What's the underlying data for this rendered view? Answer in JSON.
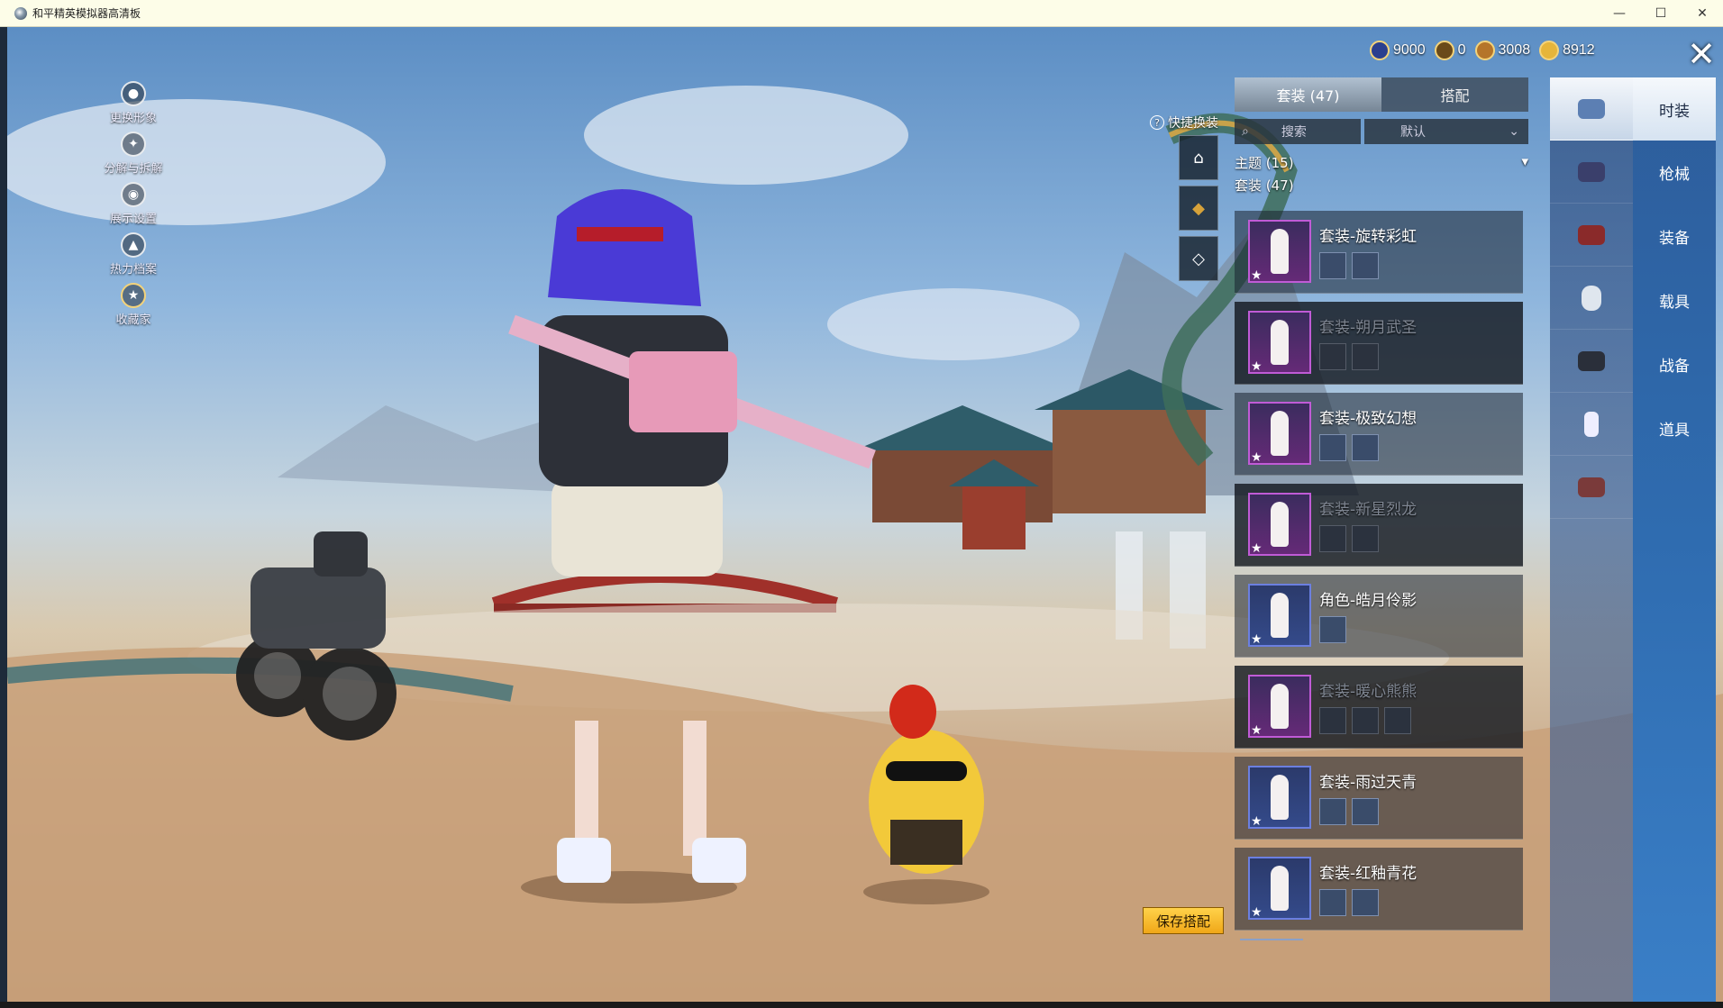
{
  "window": {
    "title": "和平精英模拟器高清板",
    "minimize": "—",
    "maximize": "☐",
    "close": "✕"
  },
  "left_tools": [
    {
      "label": "更换形象",
      "icon": "person"
    },
    {
      "label": "分解与拆解",
      "icon": "puzzle"
    },
    {
      "label": "展示设置",
      "icon": "eye"
    },
    {
      "label": "热力档案",
      "icon": "flame"
    },
    {
      "label": "收藏家",
      "icon": "medal"
    }
  ],
  "currency": [
    {
      "icon": "blue-coin",
      "value": "9000"
    },
    {
      "icon": "gold-emblem",
      "value": "0"
    },
    {
      "icon": "bronze-coin",
      "value": "3008"
    },
    {
      "icon": "gold-coin",
      "value": "8912"
    }
  ],
  "close_label": "✕",
  "quick_change": {
    "label": "快捷换装",
    "help": "?"
  },
  "tabs": [
    {
      "label": "套装 (47)",
      "active": true
    },
    {
      "label": "搭配",
      "active": false
    }
  ],
  "search": {
    "label": "搜索"
  },
  "sort": {
    "label": "默认"
  },
  "theme": {
    "label": "主题 (15)"
  },
  "suit_count": "套装 (47)",
  "outfits": [
    {
      "name": "套装-旋转彩虹",
      "dim": false,
      "minis": 2,
      "tier": "purple"
    },
    {
      "name": "套装-朔月武圣",
      "dim": true,
      "minis": 2,
      "tier": "purple"
    },
    {
      "name": "套装-极致幻想",
      "dim": false,
      "minis": 2,
      "tier": "purple"
    },
    {
      "name": "套装-新星烈龙",
      "dim": true,
      "minis": 2,
      "tier": "purple"
    },
    {
      "name": "角色-皓月伶影",
      "dim": false,
      "minis": 1,
      "tier": "blue"
    },
    {
      "name": "套装-暖心熊熊",
      "dim": true,
      "minis": 3,
      "tier": "purple"
    },
    {
      "name": "套装-雨过天青",
      "dim": false,
      "minis": 2,
      "tier": "blue"
    },
    {
      "name": "套装-红釉青花",
      "dim": false,
      "minis": 2,
      "tier": "blue"
    }
  ],
  "save_button": "保存搭配",
  "right_menu": [
    {
      "label": "时装",
      "active": true
    },
    {
      "label": "枪械",
      "active": false
    },
    {
      "label": "装备",
      "active": false
    },
    {
      "label": "载具",
      "active": false
    },
    {
      "label": "战备",
      "active": false
    },
    {
      "label": "道具",
      "active": false
    }
  ],
  "category_icons": [
    "outfit-icon",
    "backpack-icon",
    "hat-icon",
    "mask-icon",
    "glider-icon",
    "emote-icon",
    "pet-icon"
  ],
  "colors": {
    "accent": "#2f6cb0",
    "save": "#f0a718",
    "rarity_purple": "#c05bd6",
    "rarity_blue": "#6b7fe0"
  }
}
